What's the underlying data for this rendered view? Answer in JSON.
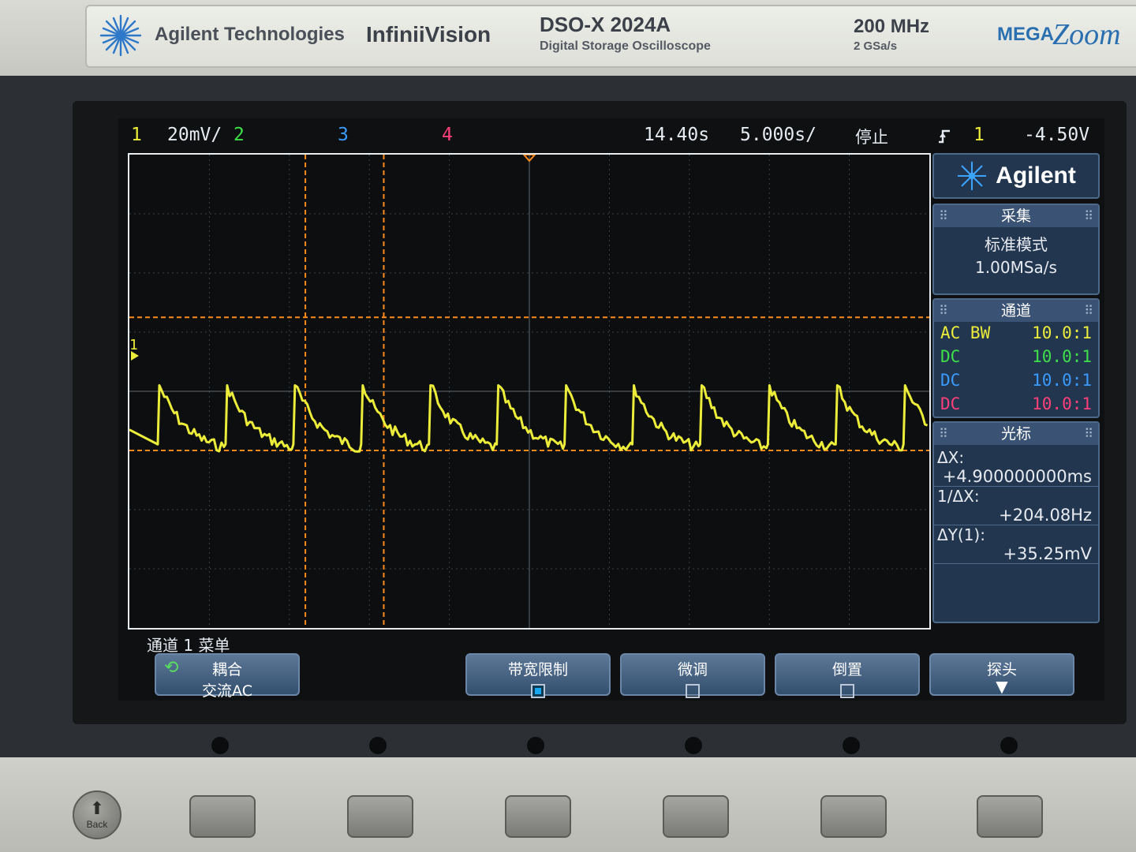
{
  "nameplate": {
    "brand": "Agilent Technologies",
    "series": "InfiniiVision",
    "model": "DSO-X 2024A",
    "model_desc": "Digital Storage Oscilloscope",
    "bandwidth": "200 MHz",
    "sample_rate": "2 GSa/s",
    "megazoom_prefix": "MEGA",
    "megazoom_suffix": "Zoom"
  },
  "status_bar": {
    "ch1_label": "1",
    "ch1_scale": "20mV/",
    "ch2_label": "2",
    "ch3_label": "3",
    "ch4_label": "4",
    "time_delay": "14.40s",
    "time_scale": "5.000s/",
    "run_state": "停止",
    "trigger_icon": "rising-edge-trigger-icon",
    "trigger_source": "1",
    "trigger_level": "-4.50V"
  },
  "waveform": {
    "ch1_marker": "1",
    "color_ch1": "#ecec3a",
    "cursor_color": "#ff8a1c",
    "peaks": 12,
    "trigger_position": 0.5,
    "time_cursor_x1_div": 2.2,
    "time_cursor_x2_div": 3.18,
    "v_cursor_y1_div": -1.0,
    "v_cursor_y2_div": 1.25
  },
  "side_panel": {
    "logo_text": "Agilent",
    "acquire": {
      "title": "采集",
      "mode": "标准模式",
      "rate": "1.00MSa/s"
    },
    "channels": {
      "title": "通道",
      "rows": [
        {
          "coupling": "AC BW",
          "probe": "10.0:1",
          "color": "#ecec3a"
        },
        {
          "coupling": "DC",
          "probe": "10.0:1",
          "color": "#3ee04a"
        },
        {
          "coupling": "DC",
          "probe": "10.0:1",
          "color": "#3a9bff"
        },
        {
          "coupling": "DC",
          "probe": "10.0:1",
          "color": "#ff3f7a"
        }
      ]
    },
    "cursors": {
      "title": "光标",
      "dx_label": "ΔX:",
      "dx_value": "+4.900000000ms",
      "inv_dx_label": "1/ΔX:",
      "inv_dx_value": "+204.08Hz",
      "dy_label": "ΔY(1):",
      "dy_value": "+35.25mV"
    }
  },
  "softkeys": {
    "menu_title": "通道 1 菜单",
    "coupling_label": "耦合",
    "coupling_value": "交流AC",
    "bw_limit_label": "带宽限制",
    "bw_limit_checked": true,
    "vernier_label": "微调",
    "vernier_checked": false,
    "invert_label": "倒置",
    "invert_checked": false,
    "probe_label": "探头"
  },
  "hardware": {
    "back_label": "Back"
  }
}
